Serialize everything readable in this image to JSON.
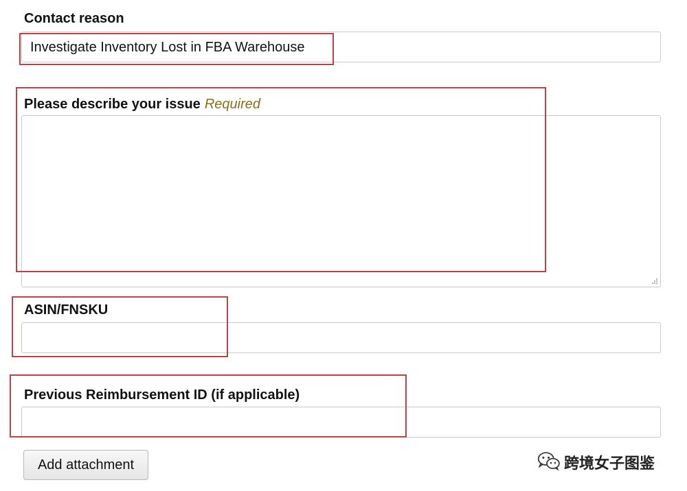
{
  "contact_reason": {
    "label": "Contact reason",
    "value": "Investigate Inventory Lost in FBA Warehouse"
  },
  "issue_description": {
    "label": "Please describe your issue",
    "required_tag": "Required",
    "value": ""
  },
  "asin_fnsku": {
    "label": "ASIN/FNSKU",
    "value": ""
  },
  "previous_reimbursement": {
    "label": "Previous Reimbursement ID (if applicable)",
    "value": ""
  },
  "attachment": {
    "button_label": "Add attachment"
  },
  "watermark": {
    "text": "跨境女子图鉴",
    "icon": "wechat-icon"
  },
  "colors": {
    "annotation_border": "#b5444a",
    "required_text": "#8a6d1c",
    "field_border": "#c9c9c9"
  }
}
